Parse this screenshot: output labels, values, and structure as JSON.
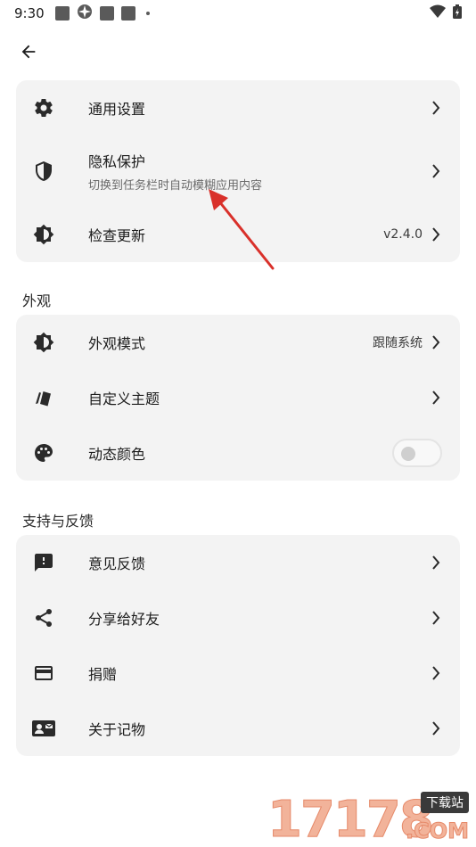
{
  "status": {
    "time": "9:30"
  },
  "general": {
    "items": [
      {
        "title": "通用设置"
      },
      {
        "title": "隐私保护",
        "subtitle": "切换到任务栏时自动模糊应用内容"
      },
      {
        "title": "检查更新",
        "value": "v2.4.0"
      }
    ]
  },
  "appearance": {
    "section_title": "外观",
    "items": [
      {
        "title": "外观模式",
        "value": "跟随系统"
      },
      {
        "title": "自定义主题"
      },
      {
        "title": "动态颜色",
        "toggle_on": false
      }
    ]
  },
  "support": {
    "section_title": "支持与反馈",
    "items": [
      {
        "title": "意见反馈"
      },
      {
        "title": "分享给好友"
      },
      {
        "title": "捐赠"
      },
      {
        "title": "关于记物"
      }
    ]
  },
  "watermark": {
    "number": "17178",
    "badge": "下载站",
    "com": ".COM"
  }
}
